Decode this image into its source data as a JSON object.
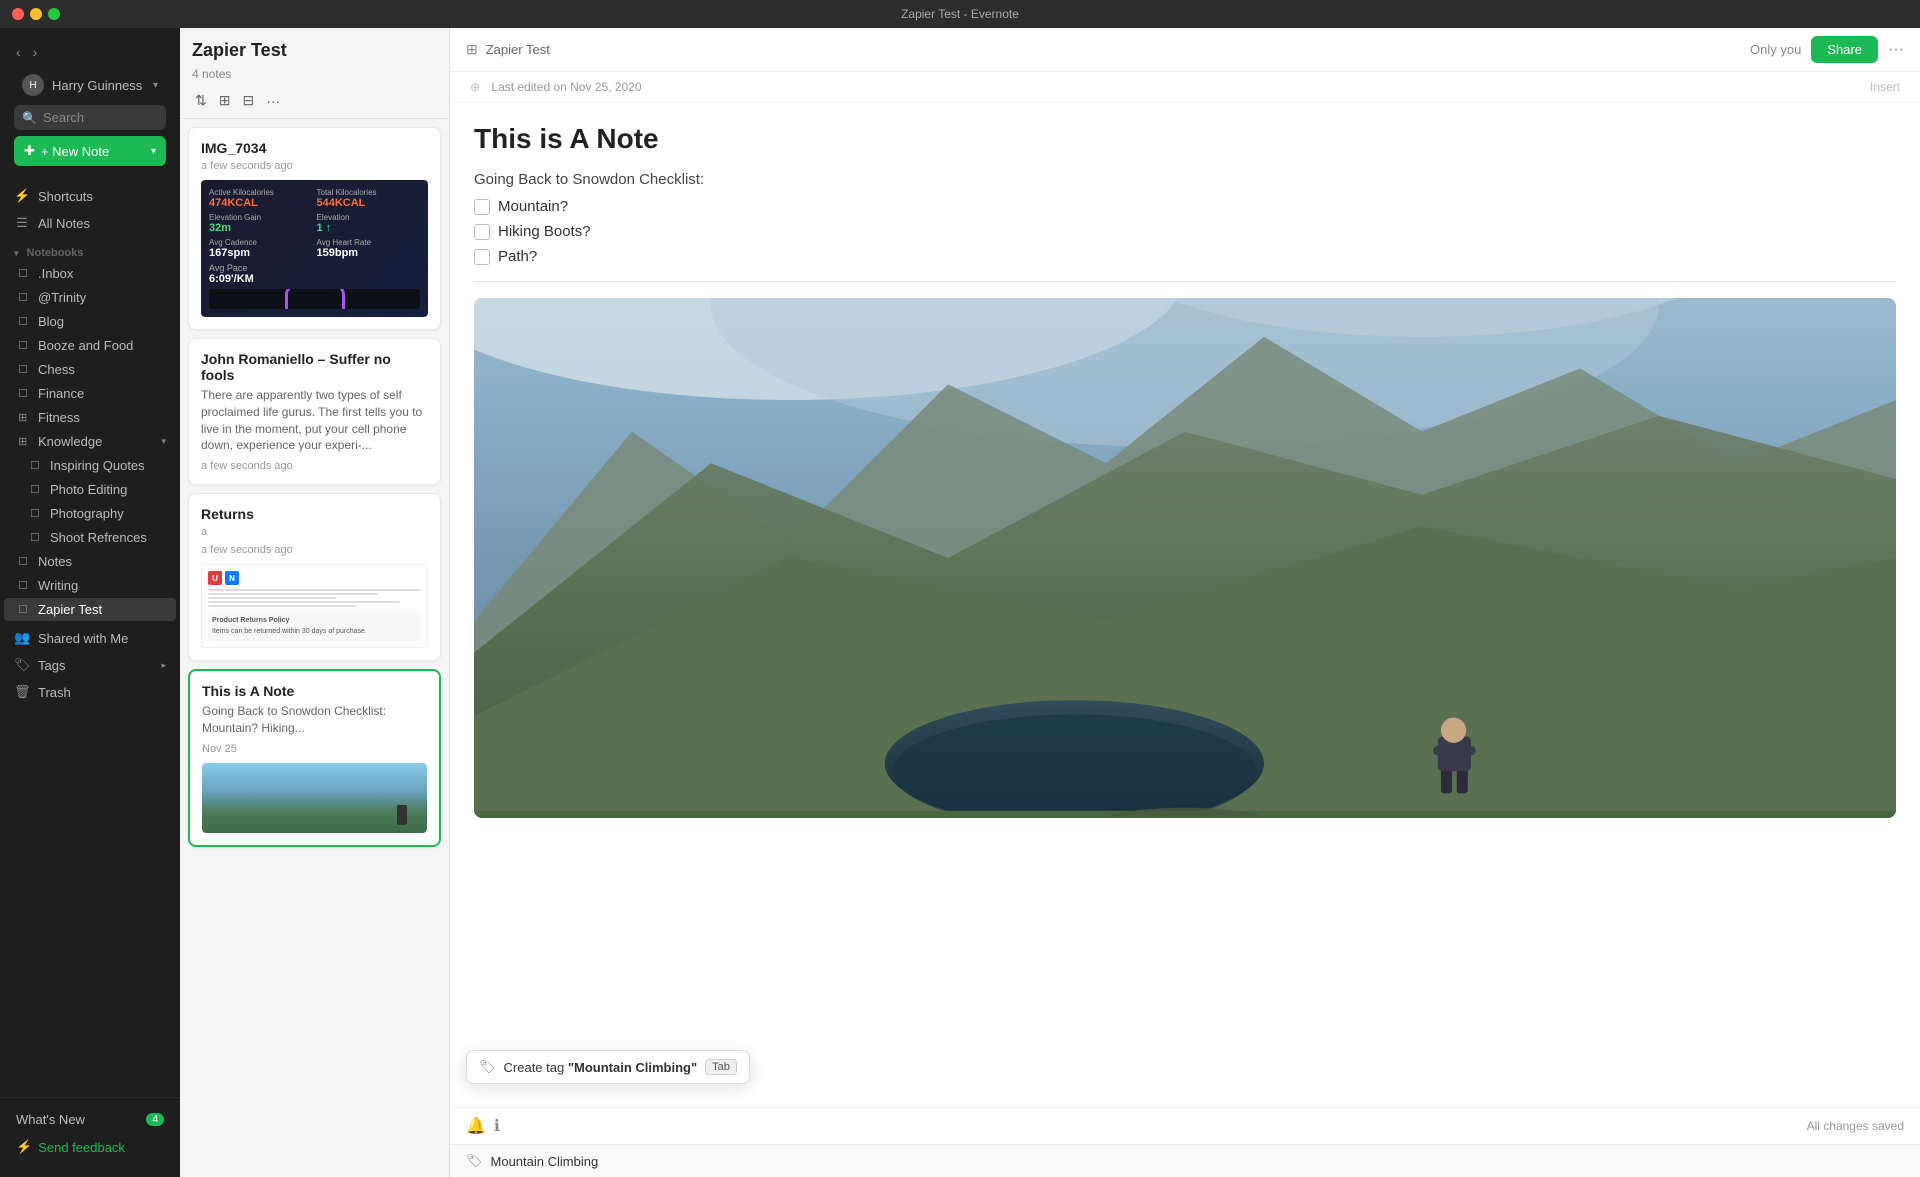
{
  "titlebar": {
    "title": "Zapier Test - Evernote"
  },
  "sidebar": {
    "user_name": "Harry Guinness",
    "search_placeholder": "Search",
    "new_note_label": "+ New Note",
    "nav_items": [
      {
        "id": "shortcuts",
        "label": "Shortcuts",
        "icon": "⚡"
      },
      {
        "id": "all-notes",
        "label": "All Notes",
        "icon": "📋"
      }
    ],
    "notebooks_label": "Notebooks",
    "notebooks": [
      {
        "id": "inbox",
        "label": ".Inbox",
        "icon": "☐",
        "indent": 1
      },
      {
        "id": "trinity",
        "label": "@Trinity",
        "icon": "☐",
        "indent": 1
      },
      {
        "id": "blog",
        "label": "Blog",
        "icon": "☐",
        "indent": 1
      },
      {
        "id": "booze-food",
        "label": "Booze and Food",
        "icon": "☐",
        "indent": 1
      },
      {
        "id": "chess",
        "label": "Chess",
        "icon": "☐",
        "indent": 1
      },
      {
        "id": "finance",
        "label": "Finance",
        "icon": "☐",
        "indent": 1
      },
      {
        "id": "fitness",
        "label": "Fitness",
        "icon": "☐",
        "indent": 1
      },
      {
        "id": "knowledge",
        "label": "Knowledge",
        "icon": "▾",
        "indent": 1,
        "expanded": true
      },
      {
        "id": "inspiring-quotes",
        "label": "Inspiring Quotes",
        "icon": "☐",
        "indent": 2
      },
      {
        "id": "photo-editing",
        "label": "Photo Editing",
        "icon": "☐",
        "indent": 2
      },
      {
        "id": "photography",
        "label": "Photography",
        "icon": "☐",
        "indent": 2
      },
      {
        "id": "shoot-references",
        "label": "Shoot Refrences",
        "icon": "☐",
        "indent": 2
      },
      {
        "id": "notes",
        "label": "Notes",
        "icon": "☐",
        "indent": 1
      },
      {
        "id": "writing",
        "label": "Writing",
        "icon": "☐",
        "indent": 1
      },
      {
        "id": "zapier-test",
        "label": "Zapier Test",
        "icon": "☐",
        "indent": 1,
        "active": true
      }
    ],
    "shared_with_me_label": "Shared with Me",
    "tags_label": "Tags",
    "trash_label": "Trash",
    "whats_new_label": "What's New",
    "whats_new_badge": "4",
    "send_feedback_label": "Send feedback"
  },
  "notes_list": {
    "title": "Zapier Test",
    "count": "4 notes",
    "notes": [
      {
        "id": "img-7034",
        "title": "IMG_7034",
        "meta": "a few seconds ago",
        "preview": "",
        "date": "",
        "has_workout_thumb": true
      },
      {
        "id": "john-romaniello",
        "title": "John Romaniello – Suffer no fools",
        "meta": "",
        "preview": "There are apparently two types of self proclaimed life gurus. The first tells you to live in the moment, put your cell phone down, experience your experi-...",
        "date": "a few seconds ago",
        "has_workout_thumb": false
      },
      {
        "id": "returns",
        "title": "Returns",
        "meta": "a",
        "preview": "",
        "date": "a few seconds ago",
        "has_knowledge_thumb": true
      },
      {
        "id": "this-is-a-note",
        "title": "This is A Note",
        "meta": "",
        "preview": "Going Back to Snowdon Checklist: Mountain? Hiking...",
        "date": "Nov 25",
        "has_mountain_thumb": true,
        "selected": true
      }
    ]
  },
  "note_detail": {
    "breadcrumb": "Zapier Test",
    "only_you_label": "Only you",
    "share_label": "Share",
    "last_edited": "Last edited on Nov 25, 2020",
    "title": "This is A Note",
    "checklist_label": "Going Back to Snowdon Checklist:",
    "checklist_items": [
      {
        "label": "Mountain?",
        "checked": false
      },
      {
        "label": "Hiking Boots?",
        "checked": false
      },
      {
        "label": "Path?",
        "checked": false
      }
    ],
    "status": "All changes saved"
  },
  "tag_popup": {
    "prefix": "Create tag ",
    "tag_name": "\"Mountain Climbing\"",
    "key_label": "Tab"
  },
  "tag_input": {
    "value": "Mountain Climbing",
    "placeholder": "Mountain Climbing"
  }
}
